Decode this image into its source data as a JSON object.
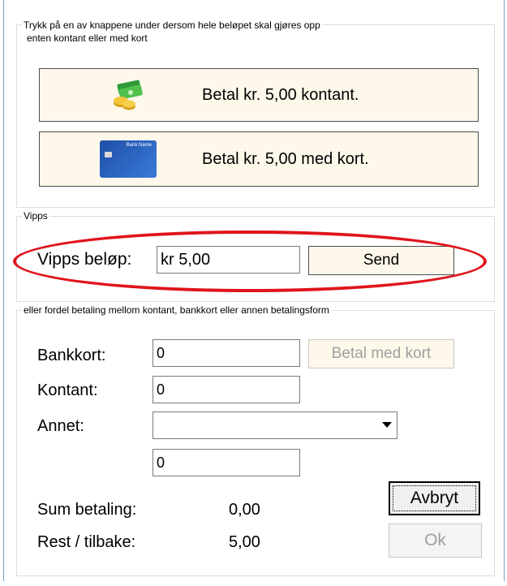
{
  "quick_pay": {
    "title": "Trykk på en av knappene under dersom hele beløpet skal gjøres opp",
    "title_line2": "enten kontant eller med kort",
    "cash_button_label": "Betal kr. 5,00 kontant.",
    "card_button_label": "Betal kr. 5,00 med kort.",
    "card_image_text": "Bank Name"
  },
  "vipps": {
    "title": "Vipps",
    "amount_label": "Vipps beløp:",
    "amount_value": "kr 5,00",
    "send_label": "Send"
  },
  "split": {
    "title": "eller fordel betaling mellom kontant, bankkort eller annen betalingsform",
    "bankkort_label": "Bankkort:",
    "bankkort_value": "0",
    "pay_card_label": "Betal med kort",
    "kontant_label": "Kontant:",
    "kontant_value": "0",
    "annet_label": "Annet:",
    "annet_selected": "",
    "annet_value": "0",
    "sum_label": "Sum betaling:",
    "sum_value": "0,00",
    "rest_label": "Rest / tilbake:",
    "rest_value": "5,00",
    "cancel_label": "Avbryt",
    "ok_label": "Ok"
  },
  "colors": {
    "highlight": "#e0141c",
    "button_bg": "#fdf8ea",
    "disabled_text": "#a0a0a0"
  }
}
